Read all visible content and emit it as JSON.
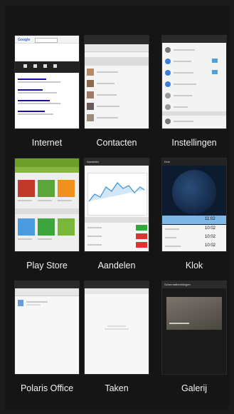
{
  "apps": [
    {
      "key": "internet",
      "label": "Internet",
      "icon": "globe-icon"
    },
    {
      "key": "contacten",
      "label": "Contacten",
      "icon": "contacts-icon"
    },
    {
      "key": "instellingen",
      "label": "Instellingen",
      "icon": "settings-icon"
    },
    {
      "key": "playstore",
      "label": "Play Store",
      "icon": "store-icon"
    },
    {
      "key": "aandelen",
      "label": "Aandelen",
      "icon": "stocks-icon"
    },
    {
      "key": "klok",
      "label": "Klok",
      "icon": "clock-icon"
    },
    {
      "key": "polaris",
      "label": "Polaris Office",
      "icon": "office-icon"
    },
    {
      "key": "taken",
      "label": "Taken",
      "icon": "tasks-icon"
    },
    {
      "key": "galerij",
      "label": "Galerij",
      "icon": "gallery-icon"
    }
  ],
  "previews": {
    "internet": {
      "logo": "Google"
    },
    "klok": {
      "title": "Klok",
      "times": [
        "11:02",
        "10:02",
        "10:02",
        "10:02"
      ]
    },
    "aandelen": {
      "title": "Aandelen"
    },
    "galerij": {
      "title": "Schermafbeeldingen"
    }
  }
}
